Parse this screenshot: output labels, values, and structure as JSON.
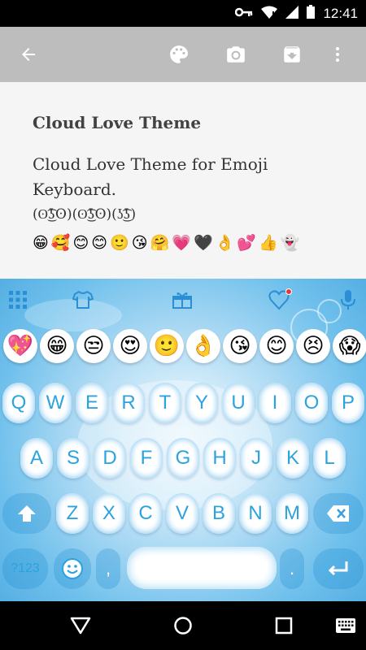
{
  "status_bar": {
    "time": "12:41",
    "icons": [
      "key-icon",
      "wifi-icon",
      "signal-icon",
      "battery-icon"
    ]
  },
  "toolbar": {
    "icons": [
      "back-arrow-icon",
      "palette-icon",
      "camera-icon",
      "archive-icon",
      "more-vert-icon"
    ]
  },
  "content": {
    "title": "Cloud Love Theme",
    "description": "Cloud Love Theme for Emoji Keyboard.",
    "kaomoji": "(ʘ͜͡ʖʘ)(ʘ͜͡ʖʘ)(ʖ͜͡ʖ)",
    "emojis": [
      "😁",
      "🥰",
      "😊",
      "😊",
      "🙂",
      "😘",
      "🤗",
      "💗",
      "🖤",
      "👌",
      "💕",
      "👍",
      "👻"
    ]
  },
  "keyboard": {
    "toolbar_icons": [
      "grid-icon",
      "tshirt-icon",
      "gift-icon",
      "heart-notification-icon",
      "microphone-icon"
    ],
    "emoji_bar": [
      "💖",
      "😁",
      "😒",
      "😍",
      "🙂",
      "👌",
      "😘",
      "😊",
      "😣",
      "😱"
    ],
    "row1": [
      "Q",
      "W",
      "E",
      "R",
      "T",
      "Y",
      "U",
      "I",
      "O",
      "P"
    ],
    "row2": [
      "A",
      "S",
      "D",
      "F",
      "G",
      "H",
      "J",
      "K",
      "L"
    ],
    "row3": [
      "Z",
      "X",
      "C",
      "V",
      "B",
      "N",
      "M"
    ],
    "symbols_label": "?123",
    "comma": ",",
    "period": "."
  },
  "nav_bar": {
    "icons": [
      "back-triangle-icon",
      "home-circle-icon",
      "recents-square-icon",
      "keyboard-icon"
    ]
  }
}
